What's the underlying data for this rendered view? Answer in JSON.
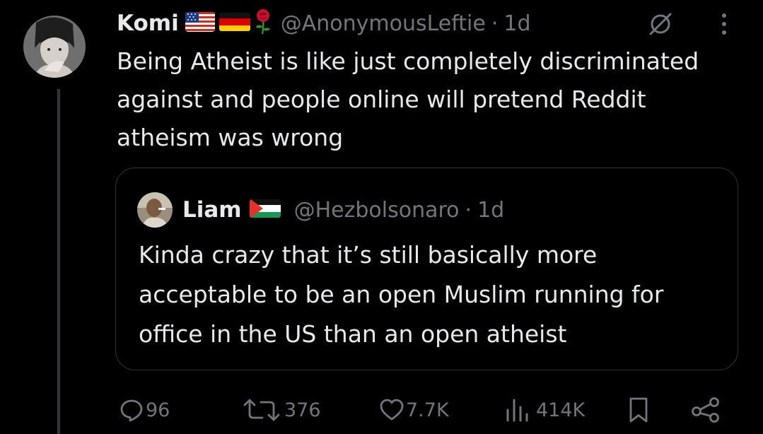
{
  "tweet": {
    "author": {
      "display_name": "Komi",
      "handle": "@AnonymousLeftie",
      "timestamp": "1d",
      "separator": "·",
      "badges": [
        "usa-flag",
        "germany-flag",
        "rose-emoji"
      ]
    },
    "text": "Being Atheist is like just completely discriminated against and people online will pretend Reddit atheism was wrong",
    "quote": {
      "author": {
        "display_name": "Liam",
        "handle": "@Hezbolsonaro",
        "timestamp": "1d",
        "separator": "·",
        "badges": [
          "palestine-flag"
        ]
      },
      "text": "Kinda crazy that it’s still basically more acceptable to be an open Muslim running for office in the US than an open atheist"
    },
    "actions": {
      "replies": "96",
      "retweets": "376",
      "likes": "7.7K",
      "views": "414K"
    }
  },
  "colors": {
    "background": "#000000",
    "text_primary": "#e7e9ea",
    "text_secondary": "#71767b",
    "border": "#2f3336",
    "thread_line": "#333639"
  },
  "icons": [
    "circle-slash-icon",
    "more-icon",
    "reply-icon",
    "retweet-icon",
    "like-icon",
    "views-icon",
    "bookmark-icon",
    "share-icon"
  ]
}
